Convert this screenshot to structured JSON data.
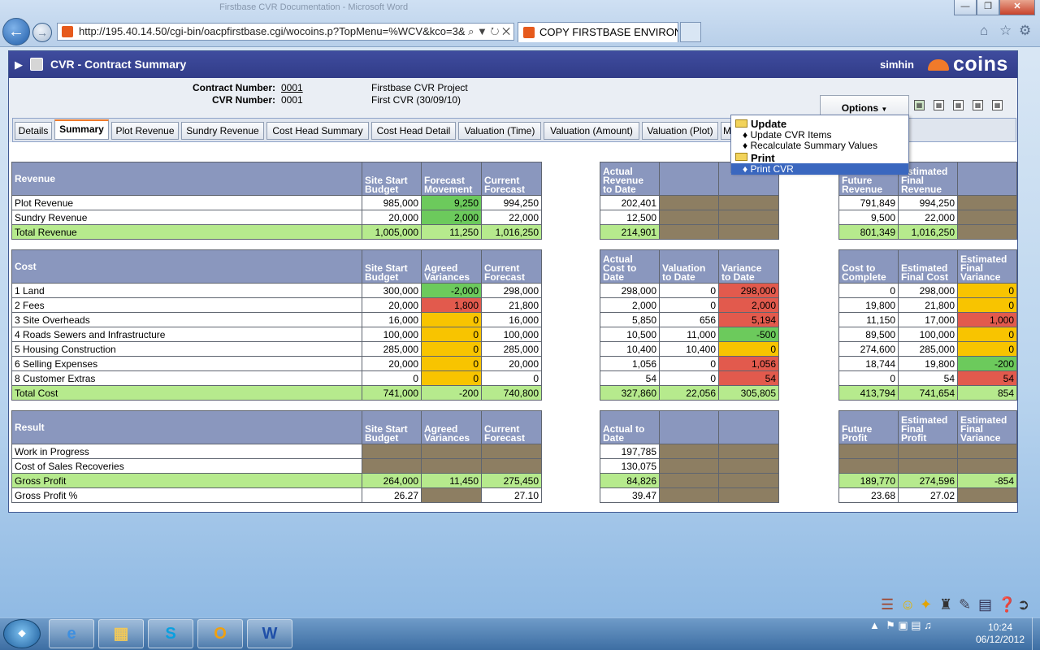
{
  "browser": {
    "window_title": "Firstbase CVR Documentation - Microsoft Word",
    "url": "http://195.40.14.50/cgi-bin/oacpfirstbase.cgi/wocoins.p?TopMenu=%WCV&kco=3&",
    "tab_title": "COPY FIRSTBASE ENVIRON..."
  },
  "app": {
    "title": "CVR - Contract Summary",
    "user": "simhin",
    "logo": "coins",
    "contract_number_label": "Contract Number:",
    "contract_number": "0001",
    "cvr_number_label": "CVR Number:",
    "cvr_number": "0001",
    "project_name": "Firstbase CVR Project",
    "cvr_name": "First CVR (30/09/10)",
    "options_label": "Options",
    "tabs": [
      "Details",
      "Summary",
      "Plot Revenue",
      "Sundry Revenue",
      "Cost Head Summary",
      "Cost Head Detail",
      "Valuation (Time)",
      "Valuation (Amount)",
      "Valuation (Plot)",
      "M"
    ]
  },
  "menu": {
    "update_label": "Update",
    "update_items": [
      "Update CVR Items",
      "Recalculate Summary Values"
    ],
    "print_label": "Print",
    "print_items": [
      "Print CVR"
    ]
  },
  "revenue": {
    "headers": {
      "name": "Revenue",
      "a": [
        "Site Start",
        "Budget"
      ],
      "b": [
        "Forecast",
        "Movement"
      ],
      "c": [
        "Current",
        "Forecast"
      ],
      "d": [
        "Actual",
        "Revenue",
        "to Date"
      ],
      "g": [
        "Future",
        "Revenue"
      ],
      "h": [
        "Estimated",
        "Final",
        "Revenue"
      ]
    },
    "rows": [
      {
        "name": "Plot Revenue",
        "a": "985,000",
        "b": "9,250",
        "c": "994,250",
        "d": "202,401",
        "g": "791,849",
        "h": "994,250"
      },
      {
        "name": "Sundry Revenue",
        "a": "20,000",
        "b": "2,000",
        "c": "22,000",
        "d": "12,500",
        "g": "9,500",
        "h": "22,000"
      },
      {
        "name": "Total Revenue",
        "a": "1,005,000",
        "b": "11,250",
        "c": "1,016,250",
        "d": "214,901",
        "g": "801,349",
        "h": "1,016,250"
      }
    ]
  },
  "cost": {
    "headers": {
      "name": "Cost",
      "a": [
        "Site Start",
        "Budget"
      ],
      "b": [
        "Agreed",
        "Variances"
      ],
      "c": [
        "Current",
        "Forecast"
      ],
      "d": [
        "Actual",
        "Cost to",
        "Date"
      ],
      "e": [
        "Valuation",
        "to Date"
      ],
      "f": [
        "Variance",
        "to Date"
      ],
      "g": [
        "Cost to",
        "Complete"
      ],
      "h": [
        "Estimated",
        "Final Cost"
      ],
      "i": [
        "Estimated",
        "Final",
        "Variance"
      ]
    },
    "rows": [
      {
        "name": "1 Land",
        "a": "300,000",
        "b": "-2,000",
        "c": "298,000",
        "d": "298,000",
        "e": "0",
        "f": "298,000",
        "g": "0",
        "h": "298,000",
        "i": "0"
      },
      {
        "name": "2 Fees",
        "a": "20,000",
        "b": "1,800",
        "c": "21,800",
        "d": "2,000",
        "e": "0",
        "f": "2,000",
        "g": "19,800",
        "h": "21,800",
        "i": "0"
      },
      {
        "name": "3 Site Overheads",
        "a": "16,000",
        "b": "0",
        "c": "16,000",
        "d": "5,850",
        "e": "656",
        "f": "5,194",
        "g": "11,150",
        "h": "17,000",
        "i": "1,000"
      },
      {
        "name": "4 Roads Sewers and Infrastructure",
        "a": "100,000",
        "b": "0",
        "c": "100,000",
        "d": "10,500",
        "e": "11,000",
        "f": "-500",
        "g": "89,500",
        "h": "100,000",
        "i": "0"
      },
      {
        "name": "5 Housing Construction",
        "a": "285,000",
        "b": "0",
        "c": "285,000",
        "d": "10,400",
        "e": "10,400",
        "f": "0",
        "g": "274,600",
        "h": "285,000",
        "i": "0"
      },
      {
        "name": "6 Selling Expenses",
        "a": "20,000",
        "b": "0",
        "c": "20,000",
        "d": "1,056",
        "e": "0",
        "f": "1,056",
        "g": "18,744",
        "h": "19,800",
        "i": "-200"
      },
      {
        "name": "8 Customer Extras",
        "a": "0",
        "b": "0",
        "c": "0",
        "d": "54",
        "e": "0",
        "f": "54",
        "g": "0",
        "h": "54",
        "i": "54"
      },
      {
        "name": "Total Cost",
        "a": "741,000",
        "b": "-200",
        "c": "740,800",
        "d": "327,860",
        "e": "22,056",
        "f": "305,805",
        "g": "413,794",
        "h": "741,654",
        "i": "854"
      }
    ]
  },
  "result": {
    "headers": {
      "name": "Result",
      "a": [
        "Site Start",
        "Budget"
      ],
      "b": [
        "Agreed",
        "Variances"
      ],
      "c": [
        "Current",
        "Forecast"
      ],
      "d": [
        "Actual to",
        "Date"
      ],
      "g": [
        "Future",
        "Profit"
      ],
      "h": [
        "Estimated",
        "Final",
        "Profit"
      ],
      "i": [
        "Estimated",
        "Final",
        "Variance"
      ]
    },
    "rows": [
      {
        "name": "Work in Progress",
        "a": "",
        "b": "",
        "c": "",
        "d": "197,785",
        "g": "",
        "h": "",
        "i": ""
      },
      {
        "name": "Cost of Sales Recoveries",
        "a": "",
        "b": "",
        "c": "",
        "d": "130,075",
        "g": "",
        "h": "",
        "i": ""
      },
      {
        "name": "Gross Profit",
        "a": "264,000",
        "b": "11,450",
        "c": "275,450",
        "d": "84,826",
        "g": "189,770",
        "h": "274,596",
        "i": "-854"
      },
      {
        "name": "Gross Profit %",
        "a": "26.27",
        "b": "",
        "c": "27.10",
        "d": "39.47",
        "g": "23.68",
        "h": "27.02",
        "i": ""
      }
    ]
  },
  "colors": {
    "header": "#8a97be",
    "total": "#b6ea8d",
    "positive": "#6cca5c",
    "negative": "#e25a4d",
    "zero": "#f8c400",
    "na": "#8d7e62"
  },
  "clock": {
    "time": "10:24",
    "date": "06/12/2012"
  }
}
